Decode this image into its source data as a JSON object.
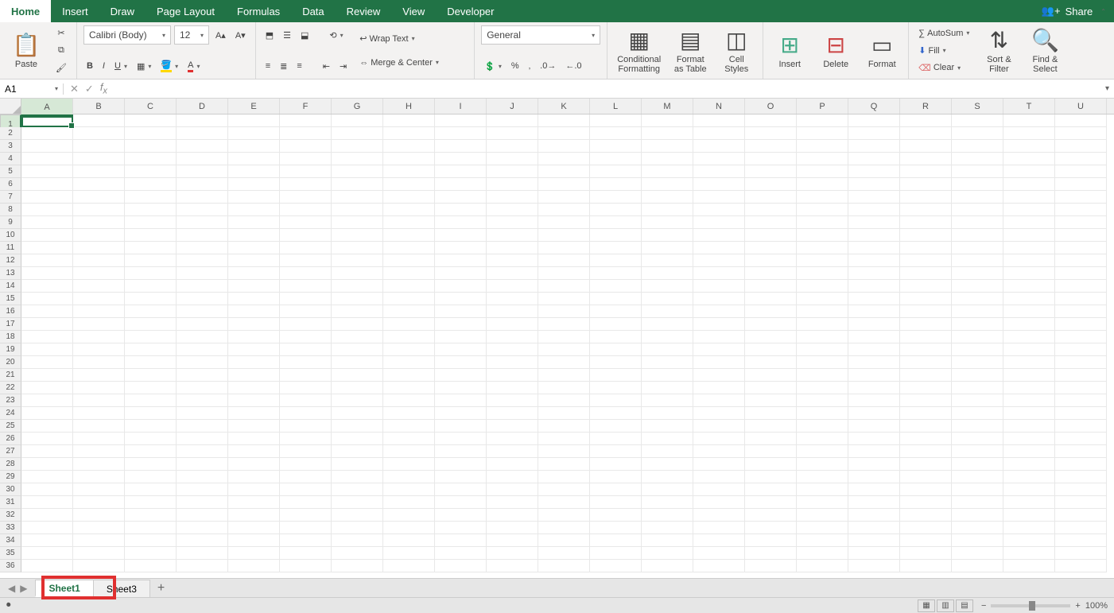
{
  "tabs": [
    "Home",
    "Insert",
    "Draw",
    "Page Layout",
    "Formulas",
    "Data",
    "Review",
    "View",
    "Developer"
  ],
  "active_tab": "Home",
  "share_label": "Share",
  "clipboard": {
    "paste": "Paste"
  },
  "font": {
    "name": "Calibri (Body)",
    "size": "12"
  },
  "alignment": {
    "wrap": "Wrap Text",
    "merge": "Merge & Center"
  },
  "number": {
    "format": "General"
  },
  "styles": {
    "cond": "Conditional\nFormatting",
    "table": "Format\nas Table",
    "cell": "Cell\nStyles"
  },
  "cells": {
    "insert": "Insert",
    "delete": "Delete",
    "format": "Format"
  },
  "editing": {
    "autosum": "AutoSum",
    "fill": "Fill",
    "clear": "Clear",
    "sort": "Sort &\nFilter",
    "find": "Find &\nSelect"
  },
  "name_box": "A1",
  "columns": [
    "A",
    "B",
    "C",
    "D",
    "E",
    "F",
    "G",
    "H",
    "I",
    "J",
    "K",
    "L",
    "M",
    "N",
    "O",
    "P",
    "Q",
    "R",
    "S",
    "T",
    "U"
  ],
  "row_count": 36,
  "active_cell": {
    "row": 1,
    "col": "A"
  },
  "sheets": [
    "Sheet1",
    "Sheet3"
  ],
  "active_sheet": "Sheet1",
  "zoom": "100%"
}
